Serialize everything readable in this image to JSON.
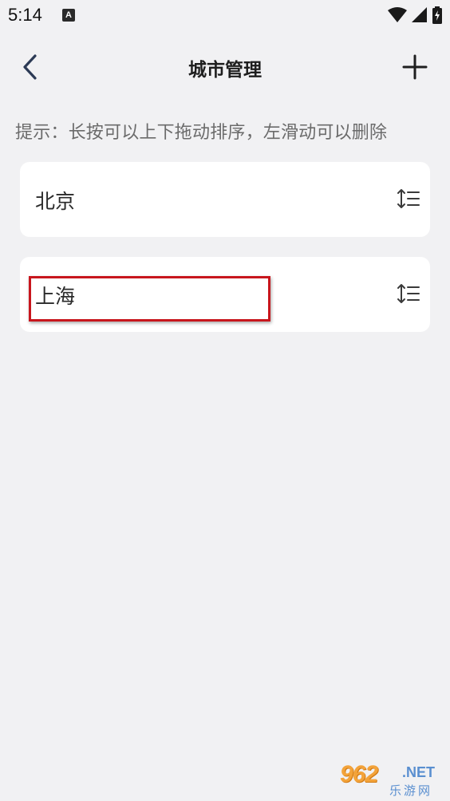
{
  "status_bar": {
    "time": "5:14",
    "app_icon_label": "A",
    "icons": [
      "wifi-icon",
      "signal-icon",
      "battery-icon"
    ]
  },
  "header": {
    "back_icon": "chevron-left-icon",
    "title": "城市管理",
    "add_icon": "plus-icon"
  },
  "hint": "提示：长按可以上下拖动排序，左滑动可以删除",
  "cities": [
    {
      "name": "北京",
      "handle_icon": "reorder-icon"
    },
    {
      "name": "上海",
      "handle_icon": "reorder-icon"
    }
  ],
  "watermark": {
    "number": "962",
    "suffix": ".NET",
    "subtitle": "乐游网"
  },
  "colors": {
    "background": "#f1f1f3",
    "card": "#ffffff",
    "accent_nav": "#2c3a55",
    "highlight": "#c8161d",
    "hint_text": "#6b6b6b"
  }
}
